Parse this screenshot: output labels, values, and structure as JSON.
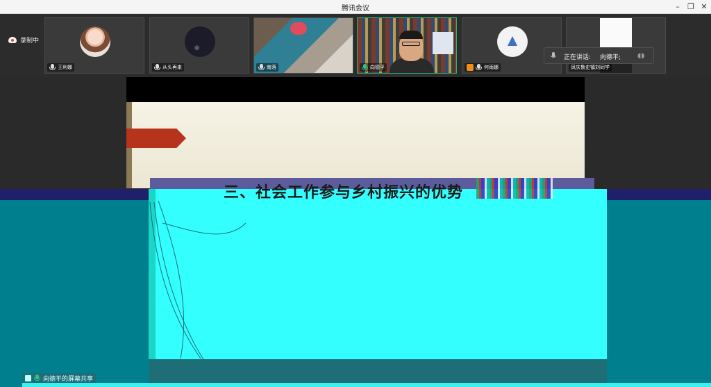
{
  "window": {
    "title": "腾讯会议",
    "minimize": "–",
    "restore": "❐",
    "close": "✕"
  },
  "recording": {
    "label": "录制中"
  },
  "participants": [
    {
      "name": "王利娜"
    },
    {
      "name": "从头再来"
    },
    {
      "name": "南落"
    },
    {
      "name": "向德平"
    },
    {
      "name": "何雨娜"
    },
    {
      "name": "凤庆鲁史镇刘同学"
    }
  ],
  "speaking": {
    "label": "正在讲话:",
    "name": "向德平;"
  },
  "slide": {
    "heading": "三、社会工作参与乡村振兴的优势"
  },
  "share": {
    "label": "向德平的屏幕共享"
  }
}
